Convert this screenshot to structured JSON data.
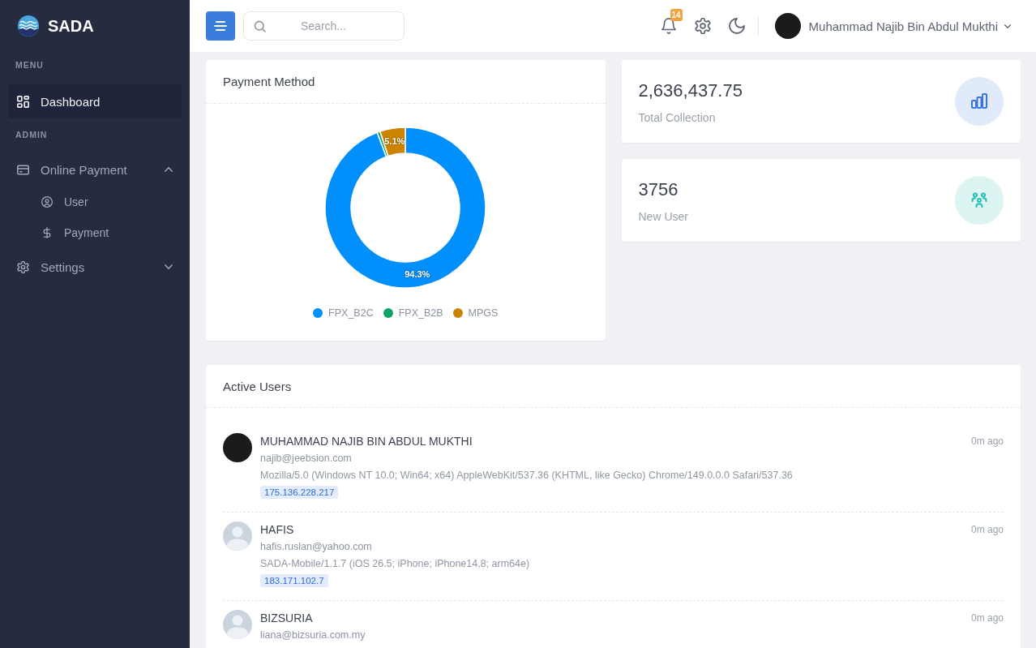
{
  "sidebar": {
    "brand": "SADA",
    "sections": [
      {
        "title": "MENU",
        "items": [
          {
            "label": "Dashboard",
            "selected": true
          }
        ]
      },
      {
        "title": "ADMIN",
        "items": [
          {
            "label": "Online Payment",
            "selected": false,
            "expanded": true,
            "children": [
              {
                "label": "User",
                "selected": false
              },
              {
                "label": "Payment",
                "selected": false
              }
            ]
          },
          {
            "label": "Settings",
            "selected": false,
            "expanded": false
          }
        ]
      }
    ]
  },
  "header": {
    "search": {
      "placeholder": "Search..."
    },
    "notifications": {
      "count": "14"
    },
    "user": {
      "name": "Muhammad Najib Bin Abdul Mukthi"
    }
  },
  "payment_method": {
    "title": "Payment Method",
    "chart_data": {
      "type": "donut",
      "categories": [
        "FPX_B2C",
        "FPX_B2B",
        "MPGS"
      ],
      "values": [
        94.3,
        0.6,
        5.1
      ],
      "colors": [
        "#008ffb",
        "#0fa36b",
        "#cc8400"
      ],
      "value_labels": [
        "94.3%",
        null,
        "5.1%"
      ],
      "legend": "bottom"
    }
  },
  "stats": [
    {
      "value": "2,636,437.75",
      "label": "Total Collection"
    },
    {
      "value": "3756",
      "label": "New User"
    }
  ],
  "active_users": {
    "title": "Active Users",
    "users": [
      {
        "kind": "photo",
        "name": "MUHAMMAD NAJIB BIN ABDUL MUKTHI",
        "email": "najib@jeebsion.com",
        "user_agent": "Mozilla/5.0 (Windows NT 10.0; Win64; x64) AppleWebKit/537.36 (KHTML, like Gecko) Chrome/149.0.0.0 Safari/537.36",
        "ip": "175.136.228.217",
        "time": "0m ago"
      },
      {
        "kind": "default",
        "name": "HAFIS",
        "email": "hafis.ruslan@yahoo.com",
        "user_agent": "SADA-Mobile/1.1.7 (iOS 26.5; iPhone; iPhone14,8; arm64e)",
        "ip": "183.171.102.7",
        "time": "0m ago"
      },
      {
        "kind": "default",
        "name": "BIZSURIA",
        "email": "liana@bizsuria.com.my",
        "time": "0m ago"
      }
    ]
  }
}
